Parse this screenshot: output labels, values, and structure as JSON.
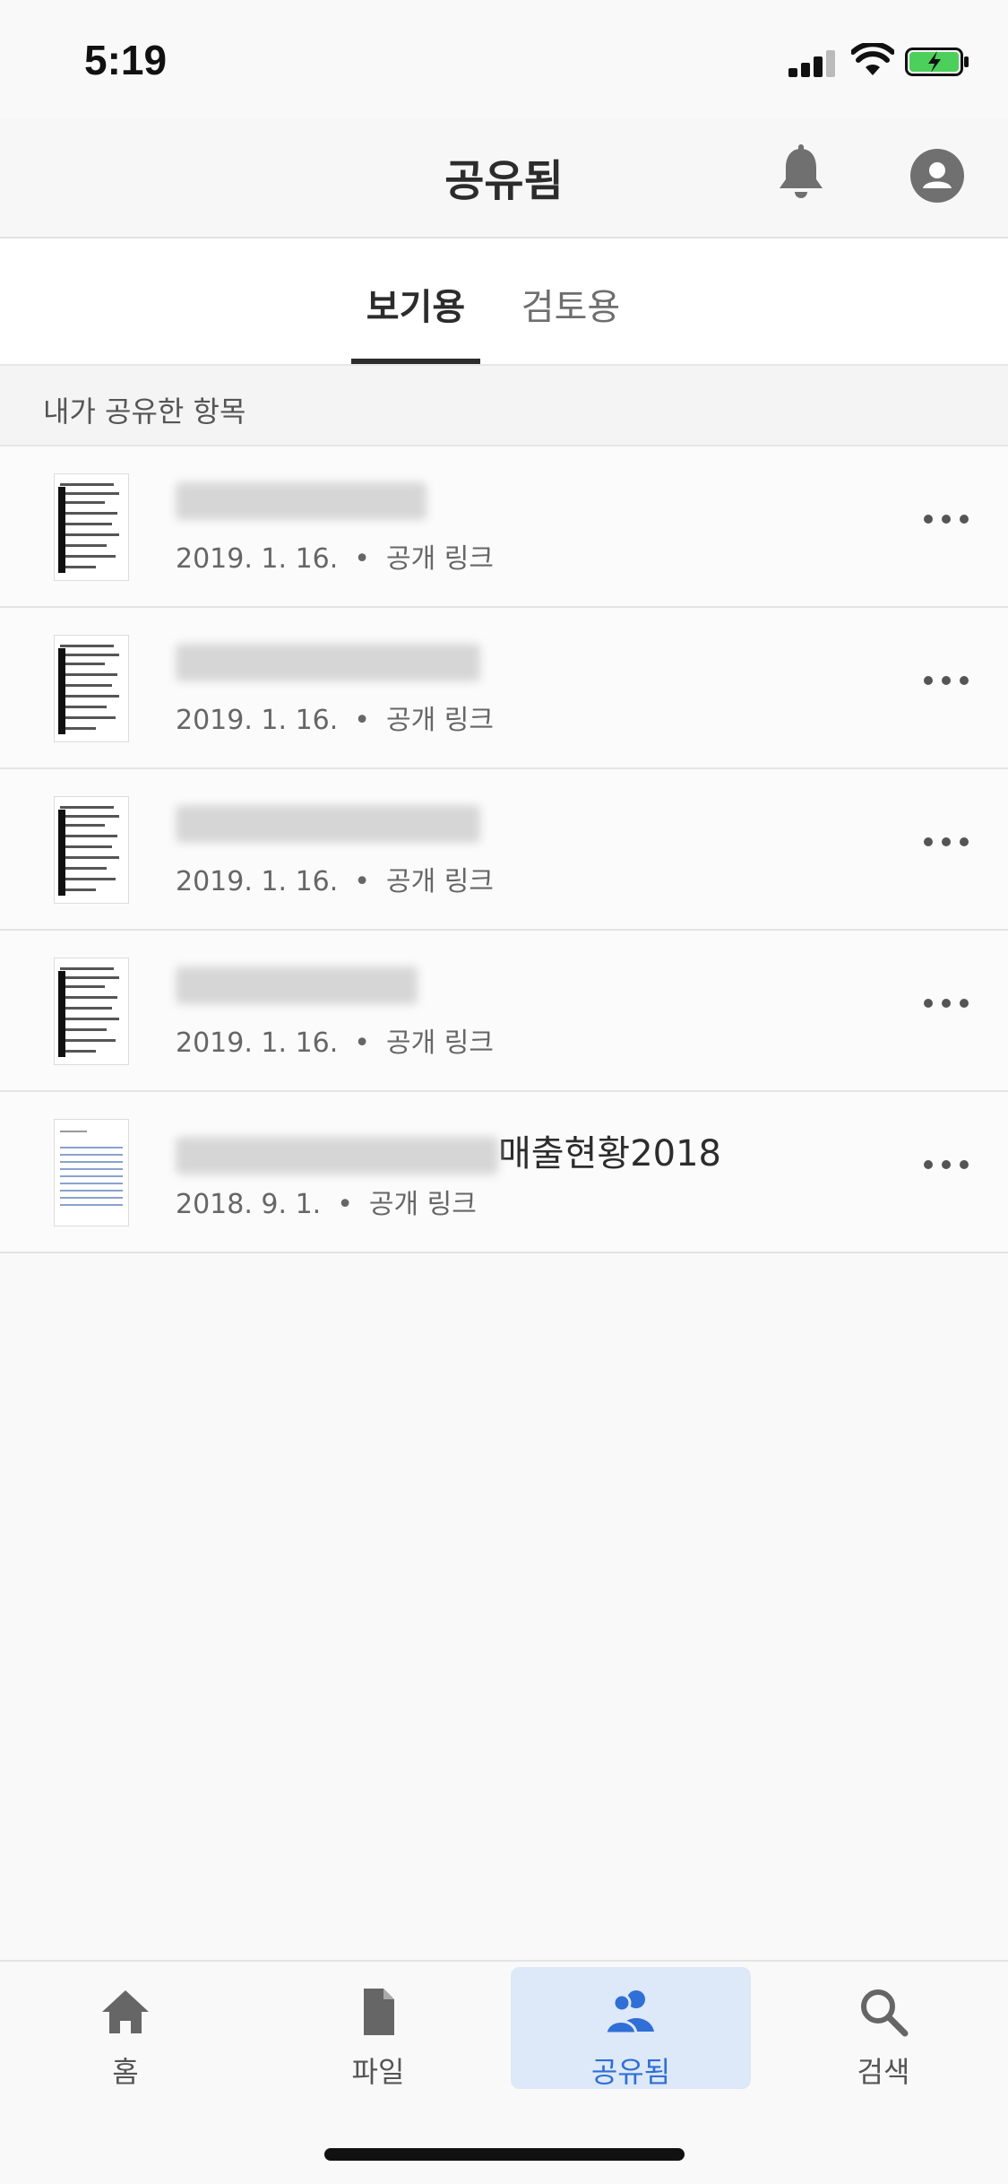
{
  "status_bar": {
    "time": "5:19"
  },
  "header": {
    "title": "공유됨"
  },
  "tabs": [
    {
      "label": "보기용",
      "active": true
    },
    {
      "label": "검토용",
      "active": false
    }
  ],
  "section": {
    "title": "내가 공유한 항목"
  },
  "items": [
    {
      "name": "",
      "date": "2019. 1. 16.",
      "type": "공개 링크"
    },
    {
      "name": "",
      "date": "2019. 1. 16.",
      "type": "공개 링크"
    },
    {
      "name": "",
      "date": "2019. 1. 16.",
      "type": "공개 링크"
    },
    {
      "name": "",
      "date": "2019. 1. 16.",
      "type": "공개 링크"
    },
    {
      "name": "매출현황2018",
      "date": "2018. 9. 1.",
      "type": "공개 링크"
    }
  ],
  "separator": "•",
  "bottom_nav": [
    {
      "label": "홈",
      "icon": "home-icon",
      "active": false
    },
    {
      "label": "파일",
      "icon": "file-icon",
      "active": false
    },
    {
      "label": "공유됨",
      "icon": "people-icon",
      "active": true
    },
    {
      "label": "검색",
      "icon": "search-icon",
      "active": false
    }
  ],
  "colors": {
    "accent": "#2f6fd6",
    "active_tab_bg": "#dde8f8"
  }
}
